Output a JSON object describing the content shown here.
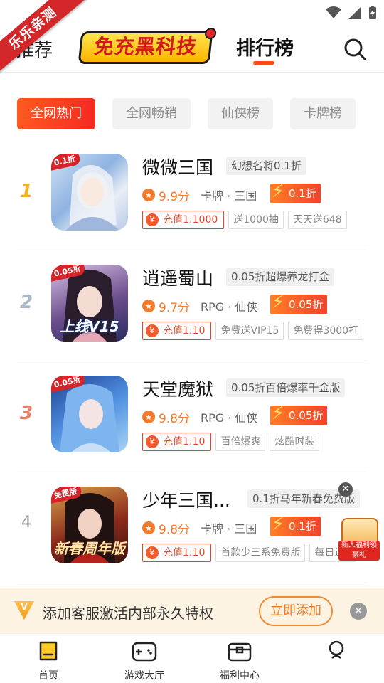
{
  "ribbon": {
    "text": "乐乐亲测"
  },
  "header": {
    "tab_left": "推荐",
    "logo_text": "免充黑科技",
    "tab_active": "排行榜"
  },
  "chips": [
    "全网热门",
    "全网畅销",
    "仙侠榜",
    "卡牌榜"
  ],
  "games": [
    {
      "rank": "1",
      "title": "微微三国",
      "promo": "幻想名将0.1折",
      "thumb_tag": "0.1折",
      "thumb_caption": "",
      "score": "9.9分",
      "genre": "卡牌 · 三国",
      "discount": "0.1折",
      "recharge": "充值1:1000",
      "tags": [
        "送1000抽",
        "天天送648"
      ]
    },
    {
      "rank": "2",
      "title": "逍遥蜀山",
      "promo": "0.05折超爆养龙打金",
      "thumb_tag": "0.05折",
      "thumb_caption": "上线V15",
      "score": "9.7分",
      "genre": "RPG · 仙侠",
      "discount": "0.05折",
      "recharge": "充值1:10",
      "tags": [
        "免费送VIP15",
        "免费得3000打"
      ]
    },
    {
      "rank": "3",
      "title": "天堂魔狱",
      "promo": "0.05折百倍爆率千金版",
      "thumb_tag": "0.05折",
      "thumb_caption": "",
      "score": "9.8分",
      "genre": "RPG · 仙侠",
      "discount": "0.05折",
      "recharge": "充值1:10",
      "tags": [
        "百倍爆爽",
        "炫酷时装"
      ]
    },
    {
      "rank": "4",
      "title": "少年三国...",
      "promo": "0.1折马年新春免费版",
      "thumb_tag": "免费版",
      "thumb_caption": "新春周年版",
      "score": "9.8分",
      "genre": "卡牌 · 三国",
      "discount": "0.1折",
      "recharge": "充值1:10",
      "tags": [
        "首款少三系免费版",
        "每日送6"
      ]
    }
  ],
  "float_widget": {
    "label": "新人福利领豪礼"
  },
  "banner": {
    "text": "添加客服激活内部永久特权",
    "button": "立即添加"
  },
  "bottom_nav": [
    {
      "label": "首页",
      "icon": "home-icon"
    },
    {
      "label": "游戏大厅",
      "icon": "gamepad-icon"
    },
    {
      "label": "福利中心",
      "icon": "gift-box-icon"
    },
    {
      "label": "",
      "icon": "profile-icon"
    }
  ],
  "colors": {
    "accent": "#f52a22",
    "orange": "#f47a2c",
    "banner_bg": "#fdf3e2"
  }
}
